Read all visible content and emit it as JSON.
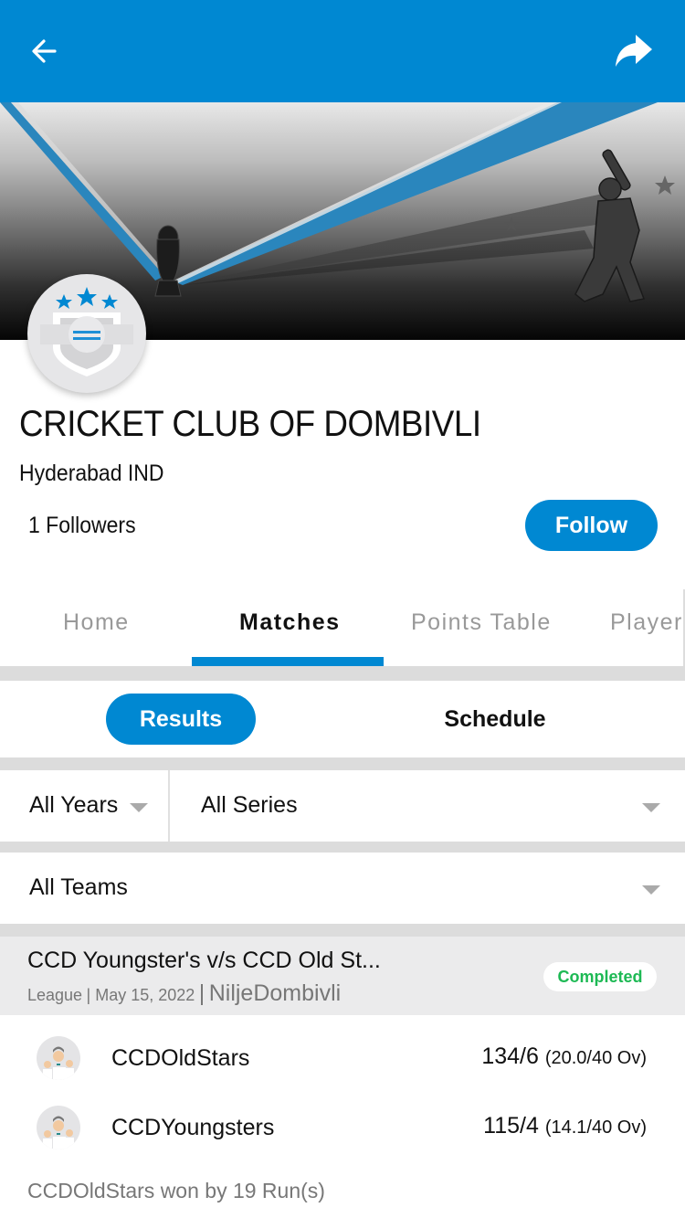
{
  "header": {
    "back_icon": "arrow-left-icon",
    "share_icon": "share-arrow-icon",
    "accent_color": "#0088d2"
  },
  "banner": {
    "image": "cricket-banner-trophy-batsman"
  },
  "club": {
    "logo_icon": "shield-three-stars-icon",
    "name": "CRICKET CLUB OF DOMBIVLI",
    "location": "Hyderabad IND",
    "followers": "1 Followers",
    "follow_label": "Follow"
  },
  "tabs": [
    {
      "label": "Home",
      "active": false
    },
    {
      "label": "Matches",
      "active": true
    },
    {
      "label": "Points Table",
      "active": false
    },
    {
      "label": "Player",
      "active": false
    }
  ],
  "subtabs": {
    "results": "Results",
    "schedule": "Schedule",
    "active": "Results"
  },
  "filters": {
    "years": "All Years",
    "series": "All Series",
    "teams": "All Teams"
  },
  "match": {
    "title": "CCD Youngster's v/s CCD Old St...",
    "type": "League",
    "date": "May 15, 2022",
    "venue": "NiljeDombivli",
    "separator": "|",
    "status": "Completed",
    "status_color": "#1db954",
    "teams": [
      {
        "name": "CCDOldStars",
        "score": "134/6",
        "overs": "(20.0/40 Ov)"
      },
      {
        "name": "CCDYoungsters",
        "score": "115/4",
        "overs": "(14.1/40 Ov)"
      }
    ],
    "result": "CCDOldStars won by 19 Run(s)"
  }
}
